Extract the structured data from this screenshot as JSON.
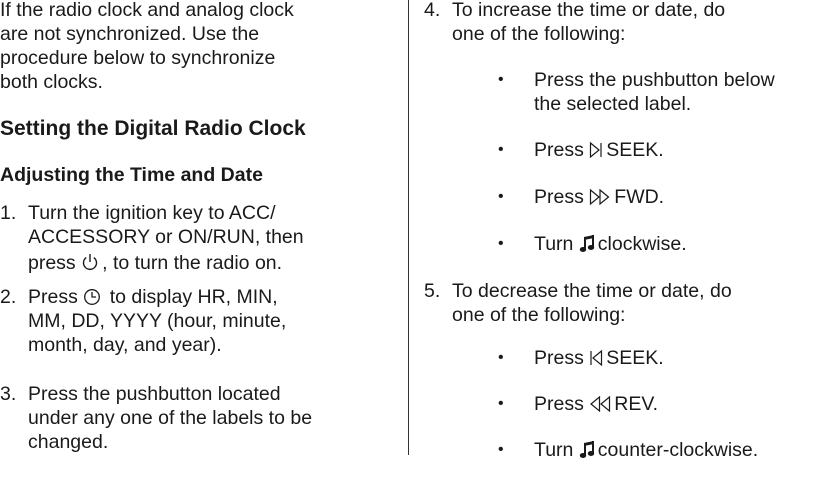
{
  "left": {
    "intro": [
      "If the radio clock and analog clock",
      "are not synchronized. Use the",
      "procedure below to synchronize",
      "both clocks."
    ],
    "heading": "Setting the Digital Radio Clock",
    "subheading": "Adjusting the Time and Date",
    "step1": {
      "num": "1.",
      "line1": "Turn the ignition key to ACC/",
      "line2": "ACCESSORY or ON/RUN, then",
      "line3_pre": "press",
      "line3_post": ", to turn the radio on.",
      "icon": "power-icon"
    },
    "step2": {
      "num": "2.",
      "line1_pre": "Press",
      "line1_post": "to display HR, MIN,",
      "line2": "MM, DD, YYYY (hour, minute,",
      "line3": "month, day, and year).",
      "icon": "clock-icon"
    },
    "step3": {
      "num": "3.",
      "line1": "Press the pushbutton located",
      "line2": "under any one of the labels to be",
      "line3": "changed."
    }
  },
  "right": {
    "step4": {
      "num": "4.",
      "line1": "To increase the time or date, do",
      "line2": "one of the following:"
    },
    "inc_bullets": [
      {
        "line1": "Press the pushbutton below",
        "line2": "the selected label."
      },
      {
        "pre": "Press",
        "post": "SEEK.",
        "icon": "seek-forward-icon"
      },
      {
        "pre": "Press",
        "post": "FWD.",
        "icon": "fast-forward-icon"
      },
      {
        "pre": "Turn",
        "post": "clockwise.",
        "icon": "music-note-icon"
      }
    ],
    "step5": {
      "num": "5.",
      "line1": "To decrease the time or date, do",
      "line2": "one of the following:"
    },
    "dec_bullets": [
      {
        "pre": "Press",
        "post": "SEEK.",
        "icon": "seek-back-icon"
      },
      {
        "pre": "Press",
        "post": "REV.",
        "icon": "rewind-icon"
      },
      {
        "pre": "Turn",
        "post": "counter-clockwise.",
        "icon": "music-note-icon"
      }
    ],
    "bullet_symbol": "•"
  }
}
